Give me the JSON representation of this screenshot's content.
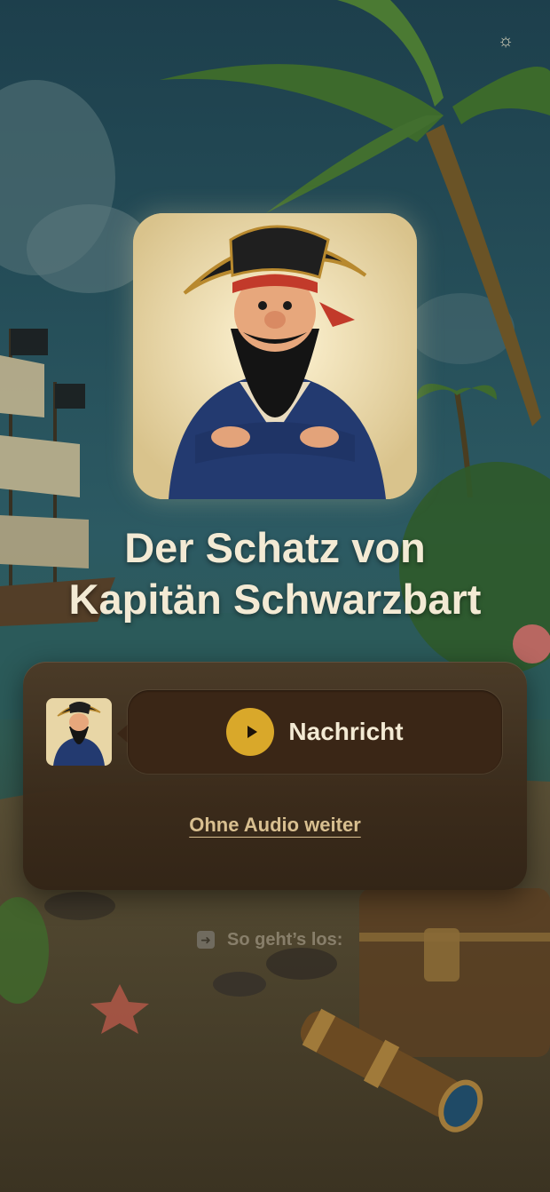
{
  "header": {
    "settings_icon": "sun-gear-icon"
  },
  "story": {
    "title_line1": "Der Schatz von",
    "title_line2": "Kapitän Schwarzbart"
  },
  "message_card": {
    "play_icon": "play-icon",
    "button_label": "Nachricht",
    "skip_label": "Ohne Audio weiter"
  },
  "hint": {
    "icon": "arrow-right-icon",
    "label": "So geht’s los:"
  },
  "colors": {
    "accent_gold": "#d9a82a",
    "title_text": "#f3ead4",
    "card_bg": "#4c3a26",
    "bubble_bg": "#3a2616",
    "link_text": "#d8bf90"
  }
}
